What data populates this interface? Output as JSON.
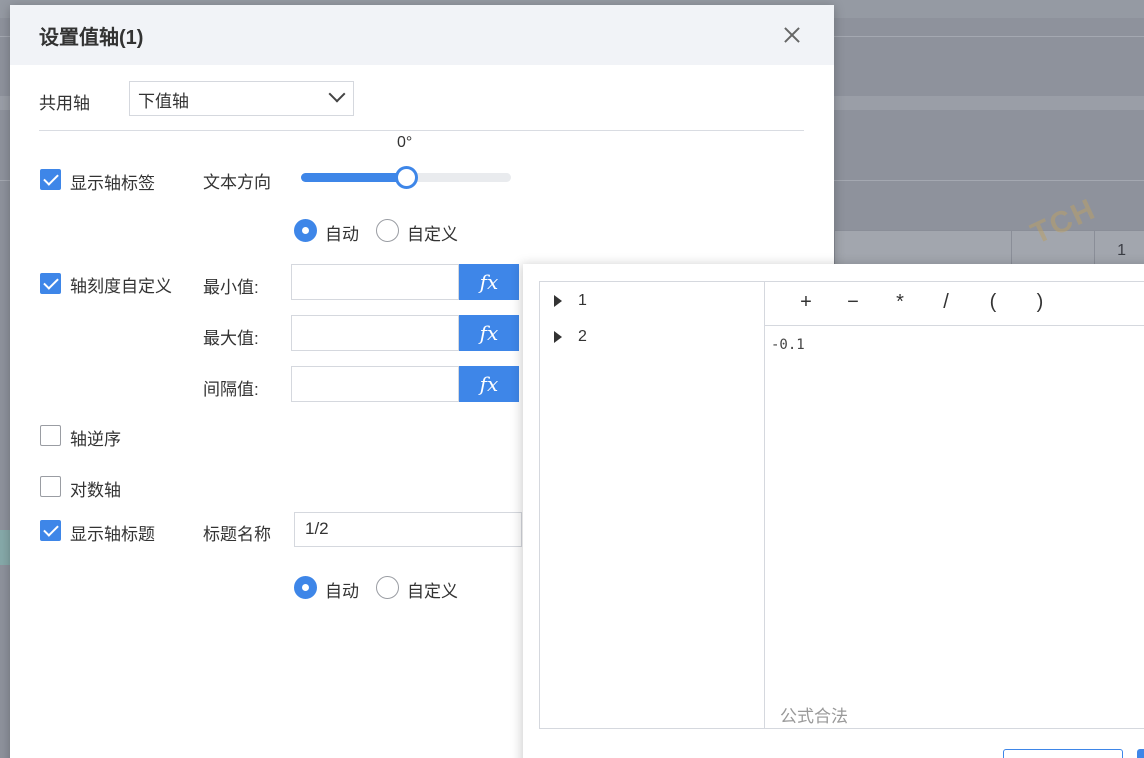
{
  "background": {
    "right_cell_value": "1",
    "watermark": "TCH"
  },
  "dialog": {
    "title": "设置值轴(1)",
    "shared_axis": {
      "label": "共用轴",
      "value": "下值轴"
    },
    "show_axis_label": {
      "label": "显示轴标签",
      "checked": true
    },
    "text_direction": {
      "label": "文本方向",
      "angle_text": "0°",
      "slider_fraction": 0.5
    },
    "label_mode": {
      "options": [
        "自动",
        "自定义"
      ],
      "selected": "自动"
    },
    "custom_scale": {
      "label": "轴刻度自定义",
      "checked": true,
      "fields": [
        {
          "label": "最小值:",
          "value": "",
          "fx": "fx"
        },
        {
          "label": "最大值:",
          "value": "",
          "fx": "fx"
        },
        {
          "label": "间隔值:",
          "value": "",
          "fx": "fx"
        }
      ]
    },
    "reverse_axis": {
      "label": "轴逆序",
      "checked": false
    },
    "log_axis": {
      "label": "对数轴",
      "checked": false
    },
    "show_axis_title": {
      "label": "显示轴标题",
      "checked": true
    },
    "title_name": {
      "label": "标题名称",
      "value": "1/2"
    },
    "title_mode": {
      "options": [
        "自动",
        "自定义"
      ],
      "selected": "自动"
    }
  },
  "formula_popup": {
    "tree_items": [
      "1",
      "2"
    ],
    "operators": [
      "+",
      "−",
      "*",
      "/",
      "(",
      ")"
    ],
    "formula": "-0.1",
    "status": "公式合法"
  },
  "colors": {
    "accent": "#3e86e8"
  }
}
